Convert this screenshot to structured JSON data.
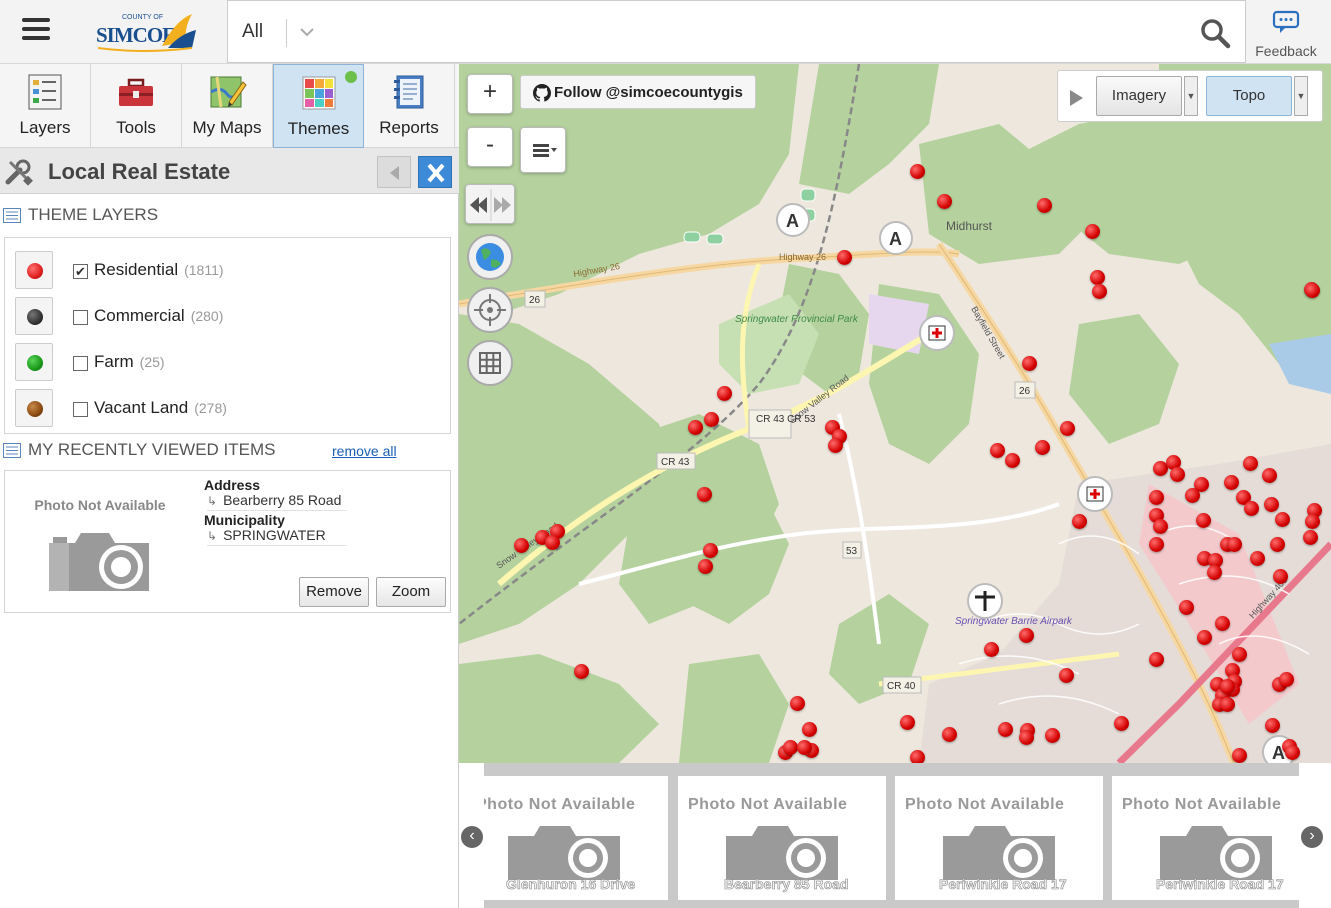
{
  "header": {
    "logo_text": "SIMCOE",
    "logo_subtext": "COUNTY OF",
    "search_scope": "All",
    "search_placeholder": "",
    "feedback_label": "Feedback"
  },
  "nav": {
    "items": [
      {
        "label": "Layers",
        "icon": "layers-icon"
      },
      {
        "label": "Tools",
        "icon": "toolbox-icon"
      },
      {
        "label": "My Maps",
        "icon": "map-pencil-icon"
      },
      {
        "label": "Themes",
        "icon": "themes-grid-icon",
        "active": true
      },
      {
        "label": "Reports",
        "icon": "report-book-icon"
      }
    ]
  },
  "theme": {
    "title": "Local Real Estate",
    "section_layers": "THEME LAYERS",
    "layers": [
      {
        "name": "Residential",
        "count": "(1811)",
        "checked": true,
        "color": "#e02020"
      },
      {
        "name": "Commercial",
        "count": "(280)",
        "checked": false,
        "color": "#333333"
      },
      {
        "name": "Farm",
        "count": "(25)",
        "checked": false,
        "color": "#1a9a1a"
      },
      {
        "name": "Vacant Land",
        "count": "(278)",
        "checked": false,
        "color": "#8b4a12"
      }
    ],
    "section_recent": "MY RECENTLY VIEWED ITEMS",
    "remove_all": "remove all",
    "recent_item": {
      "photo_text": "Photo Not Available",
      "address_label": "Address",
      "address_value": "Bearberry 85 Road",
      "municipality_label": "Municipality",
      "municipality_value": "SPRINGWATER",
      "remove_label": "Remove",
      "zoom_label": "Zoom"
    }
  },
  "map": {
    "zoom_in": "+",
    "zoom_out": "-",
    "follow_label": "Follow @simcoecountygis",
    "basemap_options": [
      "Imagery",
      "Topo"
    ],
    "basemap_selected": "Topo",
    "labels": {
      "midhurst": "Midhurst",
      "park": "Springwater Provincial Park",
      "airport": "Springwater Barrie Airpark",
      "highway26": "Highway 26",
      "hwy26_shield": "26",
      "cr43_53": "CR 43 CR 53",
      "cr43": "CR 43",
      "cr40": "CR 40",
      "r53": "53",
      "r26b": "26",
      "bayfield": "Bayfield Street",
      "snowvalley": "Snow Valley Road",
      "highway400": "Highway 400"
    },
    "colors": {
      "green": "#b5d29e",
      "residential": "#e5dcd7",
      "commercial": "#f3c9cc",
      "road_major": "#f6d7a2",
      "marker": "#d30000"
    }
  },
  "carousel": {
    "items": [
      {
        "title": "Photo Not Available",
        "caption": "Glenhuron 16 Drive"
      },
      {
        "title": "Photo Not Available",
        "caption": "Bearberry 85 Road"
      },
      {
        "title": "Photo Not Available",
        "caption": "Periwinkle Road 17"
      },
      {
        "title": "Photo Not Available",
        "caption": "Periwinkle Road 17"
      }
    ]
  }
}
